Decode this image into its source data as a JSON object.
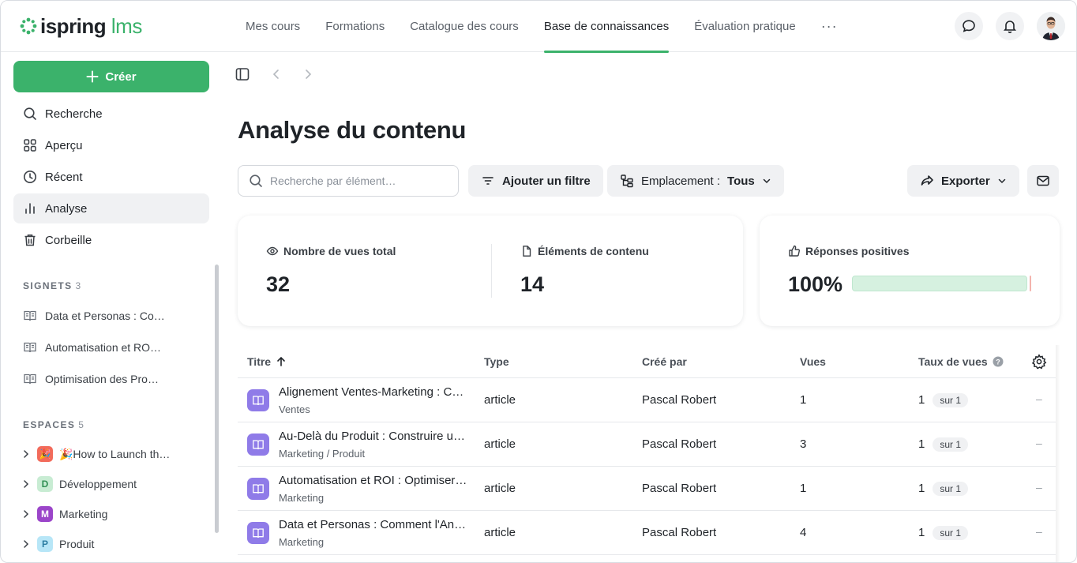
{
  "brand": {
    "name": "ispring",
    "suffix": "lms",
    "accent": "#3bb26b"
  },
  "nav": {
    "items": [
      {
        "label": "Mes cours",
        "active": false
      },
      {
        "label": "Formations",
        "active": false
      },
      {
        "label": "Catalogue des cours",
        "active": false
      },
      {
        "label": "Base de connaissances",
        "active": true
      },
      {
        "label": "Évaluation pratique",
        "active": false
      }
    ],
    "more": "···"
  },
  "sidebar": {
    "create_label": "Créer",
    "menu": [
      {
        "label": "Recherche",
        "icon": "search-icon"
      },
      {
        "label": "Aperçu",
        "icon": "grid-icon"
      },
      {
        "label": "Récent",
        "icon": "clock-icon"
      },
      {
        "label": "Analyse",
        "icon": "bar-chart-icon",
        "active": true
      },
      {
        "label": "Corbeille",
        "icon": "trash-icon"
      }
    ],
    "bookmarks_title": "SIGNETS",
    "bookmarks_count": "3",
    "bookmarks": [
      {
        "label": "Data et Personas : Co…"
      },
      {
        "label": "Automatisation et RO…"
      },
      {
        "label": "Optimisation des Pro…"
      }
    ],
    "spaces_title": "ESPACES",
    "spaces_count": "5",
    "spaces": [
      {
        "badge": "🎉",
        "label": "🎉How to Launch th…",
        "color": "#f26b5b"
      },
      {
        "badge": "D",
        "label": "Développement",
        "color": "#c8ecd3",
        "text_color": "#2f8f53"
      },
      {
        "badge": "M",
        "label": "Marketing",
        "color": "#9b45c9",
        "text_color": "#ffffff"
      },
      {
        "badge": "P",
        "label": "Produit",
        "color": "#b7e6f7",
        "text_color": "#2c7ea2"
      }
    ]
  },
  "main": {
    "title": "Analyse du contenu",
    "search_placeholder": "Recherche par élément…",
    "add_filter_label": "Ajouter un filtre",
    "location_label": "Emplacement :",
    "location_value": "Tous",
    "export_label": "Exporter"
  },
  "stats": {
    "views_label": "Nombre de vues total",
    "views_value": "32",
    "items_label": "Éléments de contenu",
    "items_value": "14",
    "positive_label": "Réponses positives",
    "positive_value": "100%",
    "positive_fraction": 1.0
  },
  "table": {
    "headers": {
      "title": "Titre",
      "type": "Type",
      "created_by": "Créé par",
      "views": "Vues",
      "view_rate": "Taux de vues"
    },
    "rows": [
      {
        "title": "Alignement Ventes-Marketing : C…",
        "location": "Ventes",
        "type": "article",
        "author": "Pascal Robert",
        "views": "1",
        "rate": "1",
        "rate_total": "sur 1",
        "extra": "–"
      },
      {
        "title": "Au-Delà du Produit : Construire un…",
        "location": "Marketing / Produit",
        "type": "article",
        "author": "Pascal Robert",
        "views": "3",
        "rate": "1",
        "rate_total": "sur 1",
        "extra": "–"
      },
      {
        "title": "Automatisation et ROI : Optimiser …",
        "location": "Marketing",
        "type": "article",
        "author": "Pascal Robert",
        "views": "1",
        "rate": "1",
        "rate_total": "sur 1",
        "extra": "–"
      },
      {
        "title": "Data et Personas : Comment l'An…",
        "location": "Marketing",
        "type": "article",
        "author": "Pascal Robert",
        "views": "4",
        "rate": "1",
        "rate_total": "sur 1",
        "extra": "–"
      }
    ]
  }
}
